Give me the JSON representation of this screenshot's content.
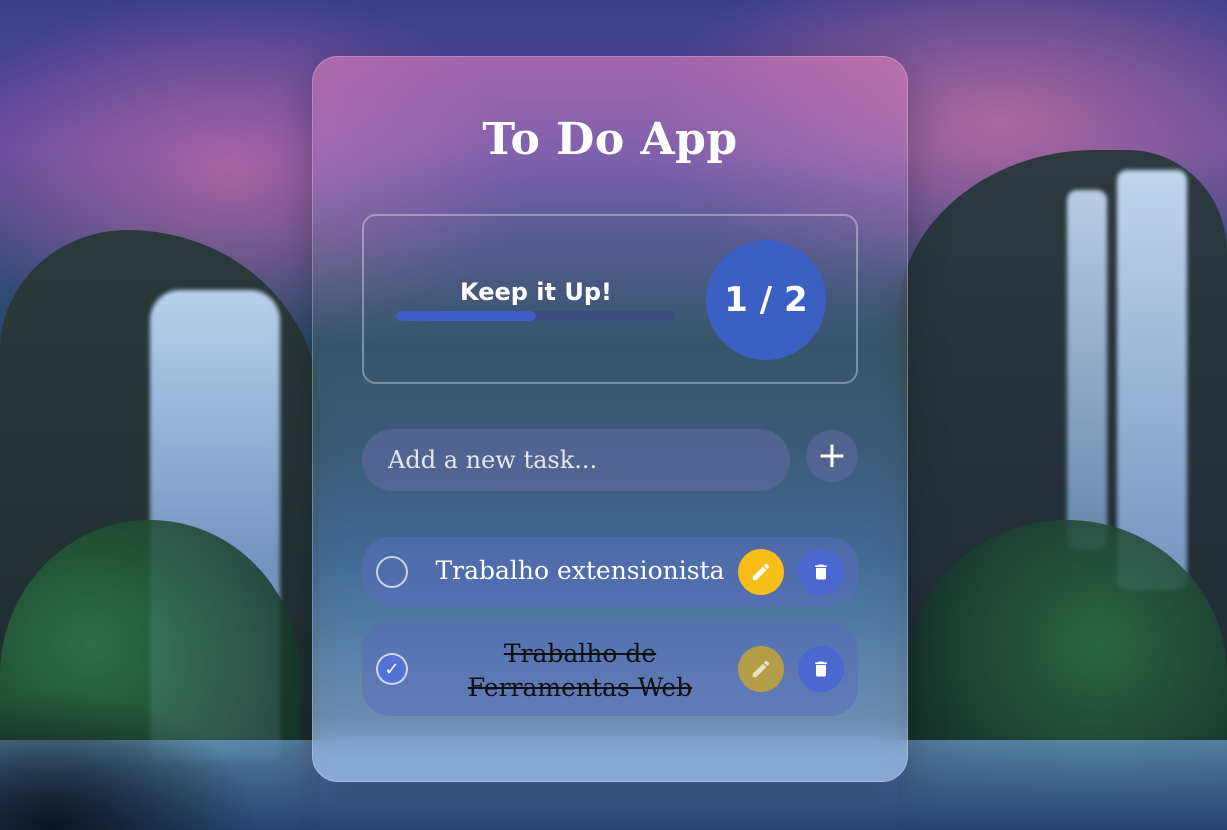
{
  "app": {
    "title": "To Do App"
  },
  "stats": {
    "message": "Keep it Up!",
    "progress_fraction": 0.5,
    "counter": "1 / 2"
  },
  "new_task": {
    "placeholder": "Add a new task...",
    "add_icon": "plus-icon",
    "add_label": "+"
  },
  "tasks": [
    {
      "text": "Trabalho extensionista",
      "completed": false,
      "check_mark": "",
      "edit_icon": "pencil-icon",
      "delete_icon": "trash-icon"
    },
    {
      "text": "Trabalho de Ferramentas Web",
      "completed": true,
      "check_mark": "✓",
      "edit_icon": "pencil-icon",
      "delete_icon": "trash-icon"
    }
  ],
  "colors": {
    "accent": "#3c5fc4",
    "edit": "#f6be16",
    "edit_disabled": "#b59e4a",
    "delete": "#4a68cf"
  }
}
